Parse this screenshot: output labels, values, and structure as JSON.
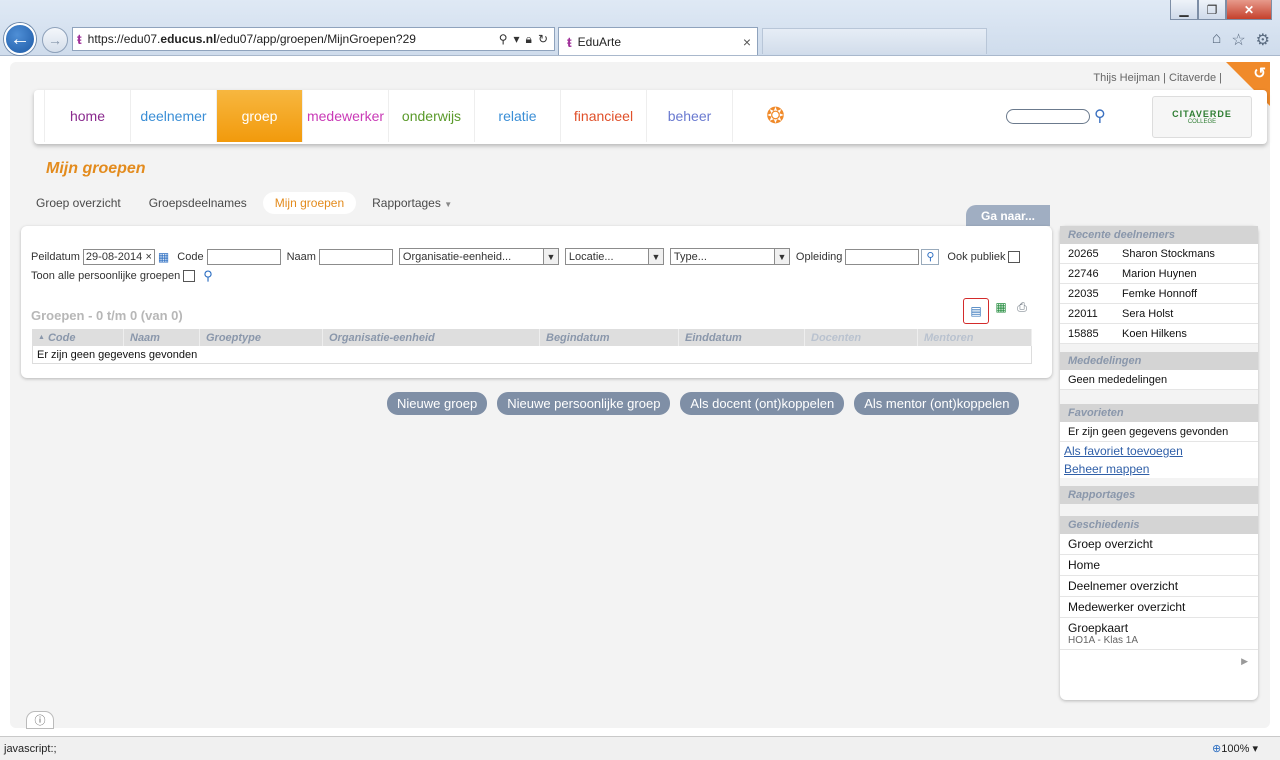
{
  "browser": {
    "url_prefix": "https://edu07.",
    "url_domain": "educus.nl",
    "url_path": "/edu07/app/groepen/MijnGroepen?29",
    "tab_title": "EduArte",
    "favicon": "ŧ"
  },
  "app": {
    "user_line": "Thijs Heijman | Citaverde |",
    "menu": [
      {
        "label": "home",
        "color": "#8a2a8e",
        "active": false
      },
      {
        "label": "deelnemer",
        "color": "#3a8ed6",
        "active": false
      },
      {
        "label": "groep",
        "color": "#ffffff",
        "active": true
      },
      {
        "label": "medewerker",
        "color": "#c93ab6",
        "active": false
      },
      {
        "label": "onderwijs",
        "color": "#5a9a2a",
        "active": false
      },
      {
        "label": "relatie",
        "color": "#3a8ed6",
        "active": false
      },
      {
        "label": "financieel",
        "color": "#e0502a",
        "active": false
      },
      {
        "label": "beheer",
        "color": "#6a7ad0",
        "active": false
      }
    ],
    "logo_text": "CITAVERDE",
    "logo_sub": "COLLEGE",
    "page_title": "Mijn groepen",
    "subnav": [
      {
        "label": "Groep overzicht",
        "active": false
      },
      {
        "label": "Groepsdeelnames",
        "active": false
      },
      {
        "label": "Mijn groepen",
        "active": true
      },
      {
        "label": "Rapportages",
        "active": false,
        "dropdown": true
      }
    ],
    "ga_naar": "Ga naar..."
  },
  "filters": {
    "peildatum_label": "Peildatum",
    "peildatum_value": "29-08-2014",
    "code_label": "Code",
    "code_value": "",
    "naam_label": "Naam",
    "naam_value": "",
    "org_eenheid": "Organisatie-eenheid...",
    "locatie": "Locatie...",
    "type": "Type...",
    "opleiding_label": "Opleiding",
    "opleiding_value": "",
    "ook_publiek": "Ook publiek",
    "toon_alle": "Toon alle persoonlijke groepen"
  },
  "results": {
    "title": "Groepen - 0 t/m 0 (van 0)",
    "columns": [
      "Code",
      "Naam",
      "Groeptype",
      "Organisatie-eenheid",
      "Begindatum",
      "Einddatum",
      "Docenten",
      "Mentoren"
    ],
    "sort_indicator": "▲",
    "empty_text": "Er zijn geen gegevens gevonden"
  },
  "actions": [
    "Nieuwe groep",
    "Nieuwe persoonlijke groep",
    "Als docent (ont)koppelen",
    "Als mentor (ont)koppelen"
  ],
  "sidebar": {
    "recent_title": "Recente deelnemers",
    "recent": [
      {
        "num": "20265",
        "name": "Sharon Stockmans"
      },
      {
        "num": "22746",
        "name": "Marion Huynen"
      },
      {
        "num": "22035",
        "name": "Femke Honnoff"
      },
      {
        "num": "22011",
        "name": "Sera Holst"
      },
      {
        "num": "15885",
        "name": "Koen Hilkens"
      }
    ],
    "mededelingen_title": "Mededelingen",
    "mededelingen_text": "Geen mededelingen",
    "favorieten_title": "Favorieten",
    "favorieten_text": "Er zijn geen gegevens gevonden",
    "fav_add": "Als favoriet toevoegen",
    "fav_manage": "Beheer mappen",
    "rapportages_title": "Rapportages",
    "geschiedenis_title": "Geschiedenis",
    "history": [
      {
        "label": "Groep overzicht",
        "sub": ""
      },
      {
        "label": "Home",
        "sub": ""
      },
      {
        "label": "Deelnemer overzicht",
        "sub": ""
      },
      {
        "label": "Medewerker overzicht",
        "sub": ""
      },
      {
        "label": "Groepkaart",
        "sub": "HO1A - Klas 1A"
      }
    ]
  },
  "status": {
    "text": "javascript:;",
    "zoom": "100%"
  }
}
